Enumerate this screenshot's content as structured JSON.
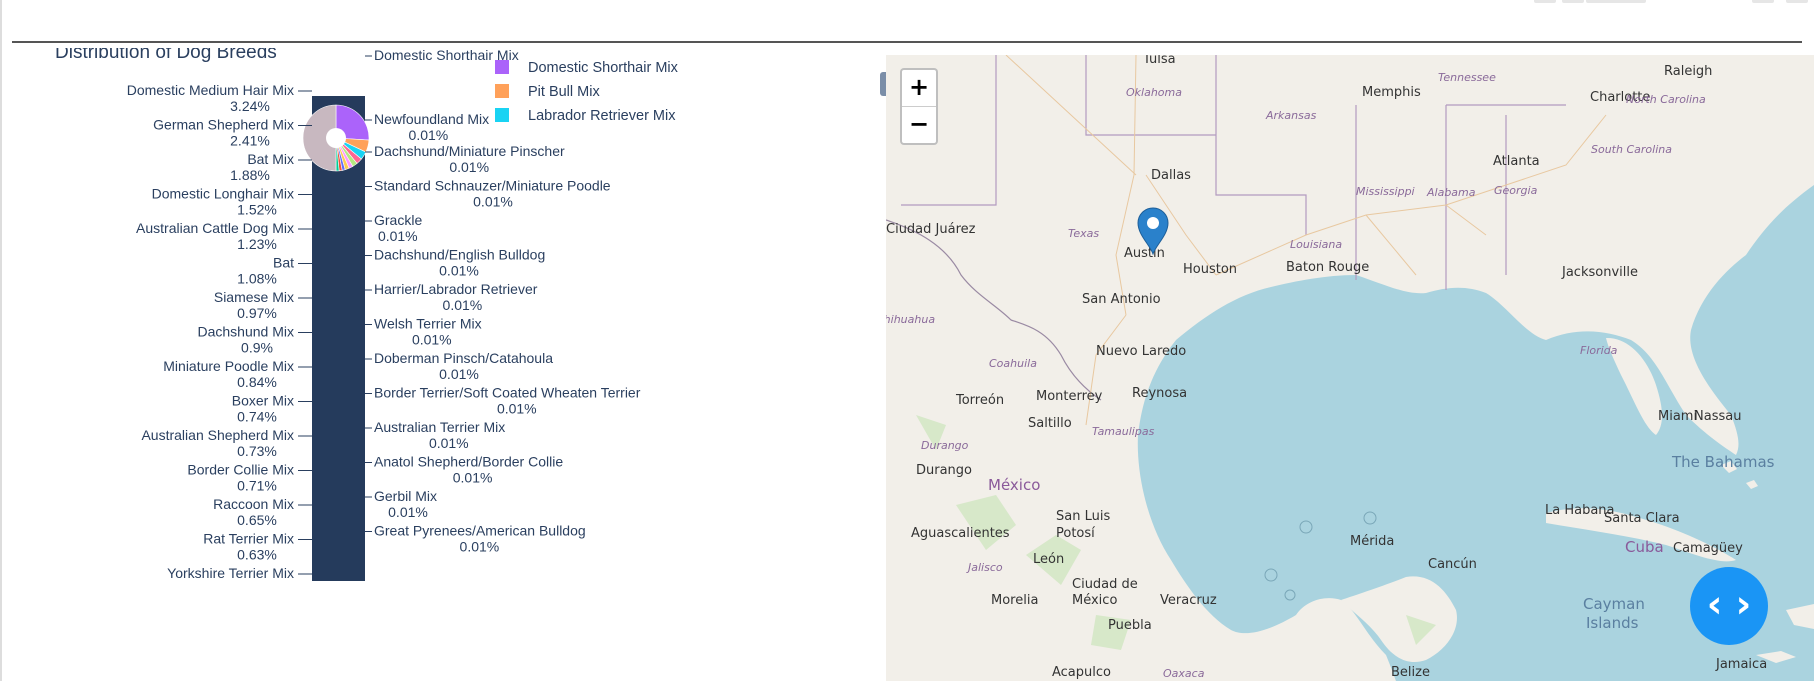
{
  "chart_data": {
    "type": "pie",
    "title": "Distribution of Dog Breeds",
    "left_labels": [
      {
        "name": "Domestic Medium Hair Mix",
        "pct": "3.24%"
      },
      {
        "name": "German Shepherd Mix",
        "pct": "2.41%"
      },
      {
        "name": "Bat Mix",
        "pct": "1.88%"
      },
      {
        "name": "Domestic Longhair Mix",
        "pct": "1.52%"
      },
      {
        "name": "Australian Cattle Dog Mix",
        "pct": "1.23%"
      },
      {
        "name": "Bat",
        "pct": "1.08%"
      },
      {
        "name": "Siamese Mix",
        "pct": "0.97%"
      },
      {
        "name": "Dachshund Mix",
        "pct": "0.9%"
      },
      {
        "name": "Miniature Poodle Mix",
        "pct": "0.84%"
      },
      {
        "name": "Boxer Mix",
        "pct": "0.74%"
      },
      {
        "name": "Australian Shepherd Mix",
        "pct": "0.73%"
      },
      {
        "name": "Border Collie Mix",
        "pct": "0.71%"
      },
      {
        "name": "Raccoon Mix",
        "pct": "0.65%"
      },
      {
        "name": "Rat Terrier Mix",
        "pct": "0.63%"
      },
      {
        "name": "Yorkshire Terrier Mix",
        "pct": ""
      }
    ],
    "right_labels": [
      {
        "name": "Domestic Shorthair Mix",
        "pct": ""
      },
      {
        "name": "Newfoundland Mix",
        "pct": "0.01%"
      },
      {
        "name": "Dachshund/Miniature Pinscher",
        "pct": "0.01%"
      },
      {
        "name": "Standard Schnauzer/Miniature Poodle",
        "pct": "0.01%"
      },
      {
        "name": "Grackle",
        "pct": "0.01%"
      },
      {
        "name": "Dachshund/English Bulldog",
        "pct": "0.01%"
      },
      {
        "name": "Harrier/Labrador Retriever",
        "pct": "0.01%"
      },
      {
        "name": "Welsh Terrier Mix",
        "pct": "0.01%"
      },
      {
        "name": "Doberman Pinsch/Catahoula",
        "pct": "0.01%"
      },
      {
        "name": "Border Terrier/Soft Coated Wheaten Terrier",
        "pct": "0.01%"
      },
      {
        "name": "Australian Terrier Mix",
        "pct": "0.01%"
      },
      {
        "name": "Anatol Shepherd/Border Collie",
        "pct": "0.01%"
      },
      {
        "name": "Gerbil Mix",
        "pct": "0.01%"
      },
      {
        "name": "Great Pyrenees/American Bulldog",
        "pct": "0.01%"
      }
    ],
    "legend": [
      {
        "name": "Domestic Shorthair Mix",
        "color": "#ab63fa"
      },
      {
        "name": "Pit Bull Mix",
        "color": "#ffa15a"
      },
      {
        "name": "Labrador Retriever Mix",
        "color": "#19d3f3"
      }
    ],
    "legend_position": "top-right"
  },
  "map": {
    "zoom_in_label": "+",
    "zoom_out_label": "−",
    "marker_city": "Austin",
    "cities": [
      "Tulsa",
      "Memphis",
      "Raleigh",
      "Charlotte",
      "Dallas",
      "Atlanta",
      "Austin",
      "Houston",
      "Baton Rouge",
      "Jacksonville",
      "San Antonio",
      "Ciudad Juárez",
      "Nuevo Laredo",
      "Torreón",
      "Monterrey",
      "Reynosa",
      "Saltillo",
      "Miami",
      "Nassau",
      "Durango",
      "México",
      "La Habana",
      "Santa Clara",
      "San Luis Potosí",
      "Mérida",
      "Cancún",
      "Aguascalientes",
      "León",
      "Camagüey",
      "Ciudad de México",
      "Morelia",
      "Veracruz",
      "Puebla",
      "Acapulco",
      "Belize"
    ],
    "states": [
      "Oklahoma",
      "Tennessee",
      "North Carolina",
      "Arkansas",
      "South Carolina",
      "Mississippi",
      "Alabama",
      "Georgia",
      "Texas",
      "Louisiana",
      "Chihuahua",
      "Florida",
      "Coahuila",
      "Tamaulipas",
      "Durango",
      "Jalisco",
      "Oaxaca"
    ],
    "countries": [
      "México",
      "Cuba"
    ],
    "water_labels": [
      "The Bahamas",
      "Cayman Islands",
      "Jamaica"
    ]
  },
  "fab": {
    "icon": "code-icon",
    "label": "‹ ›"
  },
  "colors": {
    "accent": "#1a95f5",
    "chart_bar": "#253b5c",
    "water": "#aad3df",
    "land": "#f2efe9"
  }
}
